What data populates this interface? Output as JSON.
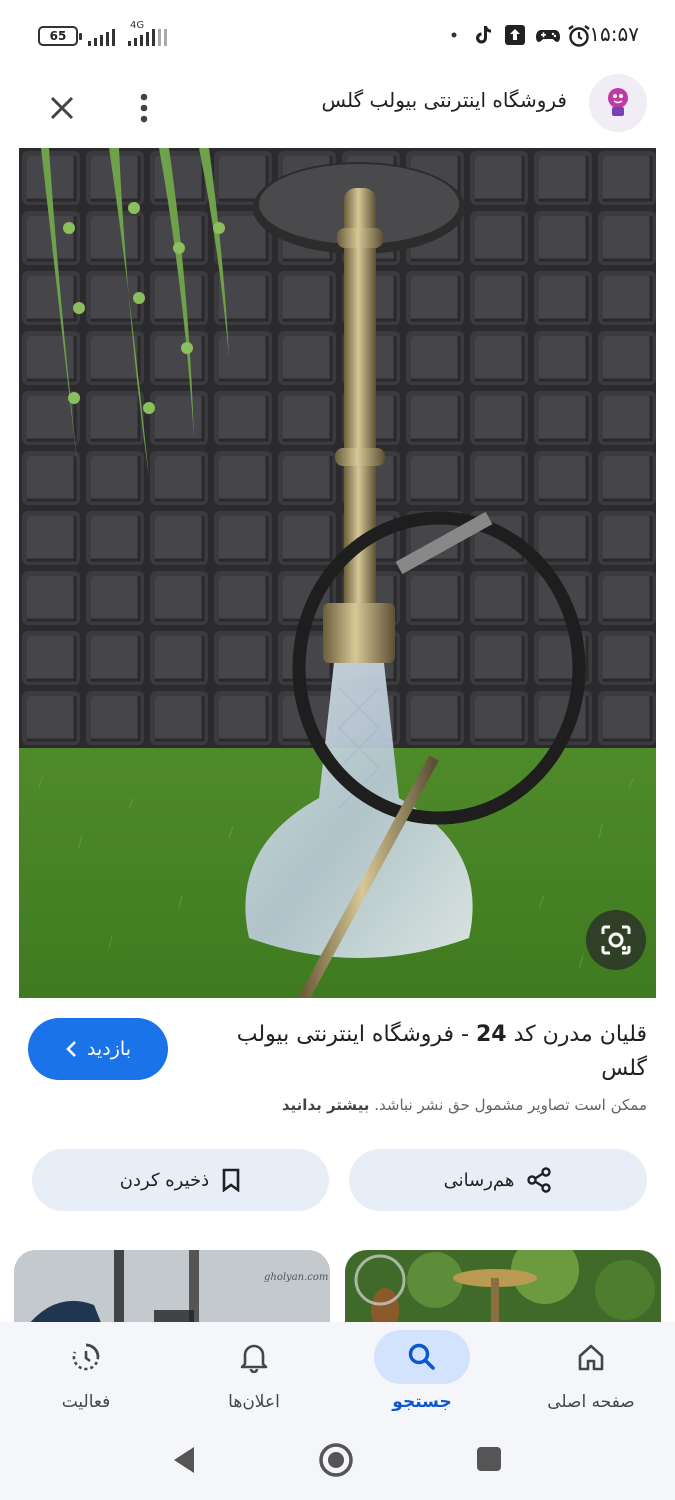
{
  "status_bar": {
    "battery": "65",
    "network": "4G",
    "time": "۱۵:۵۷",
    "icons": [
      "dot-icon",
      "tiktok-icon",
      "upload-icon",
      "game-icon",
      "alarm-icon"
    ]
  },
  "header": {
    "title": "فروشگاه اینترنتی بیولب گلس",
    "icons": {
      "close": "close-icon",
      "more": "more-vert-icon",
      "logo": "site-logo"
    }
  },
  "result": {
    "title_prefix": "قلیان مدرن کد ",
    "title_code": "24",
    "title_suffix": " - فروشگاه اینترنتی بیولب گلس",
    "copyright_text": "ممکن است تصاویر مشمول حق نشر نباشد.",
    "learn_more": "بیشتر بدانید",
    "visit_label": "بازدید"
  },
  "actions": {
    "share_label": "هم‌رسانی",
    "save_label": "ذخیره کردن"
  },
  "related": {
    "left_watermark": "gholyan.com"
  },
  "bottom_nav": [
    {
      "label": "صفحه اصلی",
      "icon": "home-icon",
      "active": false
    },
    {
      "label": "جستجو",
      "icon": "search-icon",
      "active": true
    },
    {
      "label": "اعلان‌ها",
      "icon": "bell-icon",
      "active": false
    },
    {
      "label": "فعالیت",
      "icon": "activity-icon",
      "active": false
    }
  ],
  "colors": {
    "accent": "#1a73e8",
    "pill_bg": "#e8eef7",
    "nav_active_bg": "#d3e3fd",
    "nav_active_text": "#0b57d0"
  }
}
